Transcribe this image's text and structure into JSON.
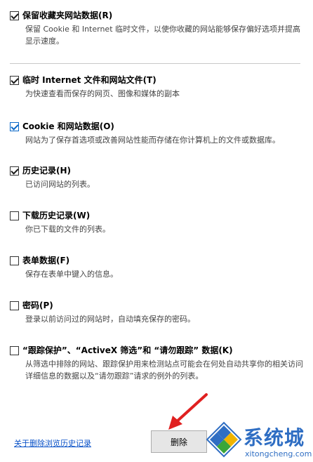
{
  "options": [
    {
      "title": "保留收藏夹网站数据(R)",
      "desc": "保留 Cookie 和 Internet 临时文件，以使你收藏的网站能够保存偏好选项并提高显示速度。",
      "checked": true
    },
    {
      "title": "临时 Internet 文件和网站文件(T)",
      "desc": "为快速查看而保存的网页、图像和媒体的副本",
      "checked": true
    },
    {
      "title": "Cookie 和网站数据(O)",
      "desc": "网站为了保存首选项或改善网站性能而存储在你计算机上的文件或数据库。",
      "checked": true
    },
    {
      "title": "历史记录(H)",
      "desc": "已访问网站的列表。",
      "checked": true
    },
    {
      "title": "下载历史记录(W)",
      "desc": "你已下载的文件的列表。",
      "checked": false
    },
    {
      "title": "表单数据(F)",
      "desc": "保存在表单中键入的信息。",
      "checked": false
    },
    {
      "title": "密码(P)",
      "desc": "登录以前访问过的网站时，自动填充保存的密码。",
      "checked": false
    },
    {
      "title": "“跟踪保护”、“ActiveX 筛选”和 “请勿跟踪” 数据(K)",
      "desc": "从筛选中排除的网站、跟踪保护用来检测站点可能会在何处自动共享你的相关访问详细信息的数据以及“请勿跟踪”请求的例外的列表。",
      "checked": false
    }
  ],
  "footer": {
    "link_label": "关于删除浏览历史记录",
    "delete_label": "删除"
  },
  "watermark": {
    "brand": "系统城",
    "url": "xitongcheng.com"
  },
  "colors": {
    "link": "#0a52c8",
    "checkbox_focus": "#0a68c8",
    "arrow": "#e02020",
    "watermark": "#2f6ec3"
  }
}
